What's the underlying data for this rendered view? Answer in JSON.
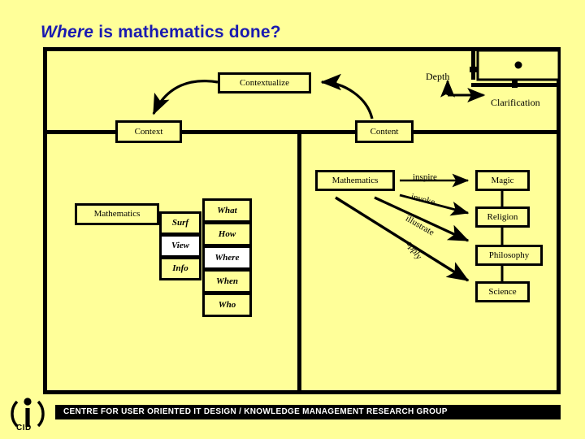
{
  "slide": {
    "title_italic_part": "Where",
    "title_rest": " is mathematics done?",
    "title_full": "Where is mathematics done?",
    "background_color": "#FFFF99",
    "title_color": "#1A1AB0",
    "line_color": "#000000"
  },
  "top_flow": {
    "contextualize": "Contextualize",
    "context": "Context",
    "content": "Content"
  },
  "inset_plot": {
    "y_axis_label": "Depth",
    "x_axis_label": "Clarification",
    "point_marker": "dot"
  },
  "left_panel": {
    "root": "Mathematics",
    "modes": [
      "Surf",
      "View",
      "Info"
    ],
    "questions": [
      "What",
      "How",
      "Where",
      "When",
      "Who"
    ],
    "highlighted_question": "Where"
  },
  "right_panel": {
    "root": "Mathematics",
    "arrow_labels": [
      "inspire",
      "invoke",
      "illustrate",
      "apply"
    ],
    "targets": [
      "Magic",
      "Religion",
      "Philosophy",
      "Science"
    ]
  },
  "footer": {
    "text": "CENTRE FOR USER ORIENTED IT DESIGN / KNOWLEDGE MANAGEMENT RESEARCH GROUP",
    "logo_text": "CID",
    "bar_color": "#000000",
    "text_color": "#FFFFFF"
  }
}
